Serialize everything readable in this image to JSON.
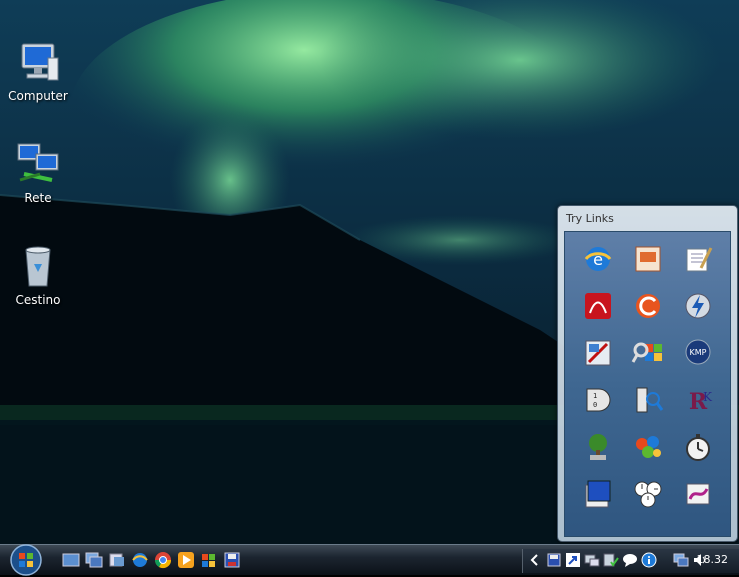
{
  "desktop": {
    "icons": [
      {
        "label": "Computer"
      },
      {
        "label": "Rete"
      },
      {
        "label": "Cestino"
      }
    ]
  },
  "gadget": {
    "title": "Try Links",
    "tiles": [
      "internet-explorer-icon",
      "presentation-icon",
      "notepad-icon",
      "acrobat-reader-icon",
      "ccleaner-icon",
      "speed-bolt-icon",
      "paint-icon",
      "windows-search-icon",
      "kmplayer-icon",
      "logic-gate-icon",
      "network-scanner-icon",
      "rsk-icon",
      "tree-tool-icon",
      "flowers-icon",
      "stopwatch-icon",
      "notebook-icon",
      "clocks-icon",
      "disk-tool-icon"
    ]
  },
  "taskbar": {
    "start_label": "Start",
    "quick_launch": [
      "show-desktop-icon",
      "switch-windows-icon",
      "explorer-icon",
      "ie-icon",
      "chrome-icon",
      "media-player-icon",
      "windows-flag-icon",
      "floppy-icon"
    ],
    "tray_icons": [
      "chevron-left-icon",
      "floppy-icon",
      "shortcut-icon",
      "devices-icon",
      "shield-check-icon",
      "chat-icon",
      "info-icon",
      "network-icon",
      "volume-icon"
    ],
    "clock": "18.32"
  },
  "colors": {
    "aurora": "#58d07a",
    "panel_blue": "#3f6791",
    "taskbar": "#1c2530"
  }
}
